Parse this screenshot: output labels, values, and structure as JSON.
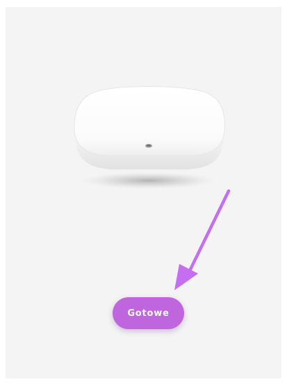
{
  "colors": {
    "page_background": "#ffffff",
    "panel_background": "#f4f4f4",
    "accent": "#bf66de",
    "arrow": "#c56ff0",
    "button_text": "#ffffff"
  },
  "illustration": {
    "device": "device-illustration",
    "pointer": "arrow-pointing-to-button"
  },
  "done_button": {
    "label": "Gotowe"
  }
}
